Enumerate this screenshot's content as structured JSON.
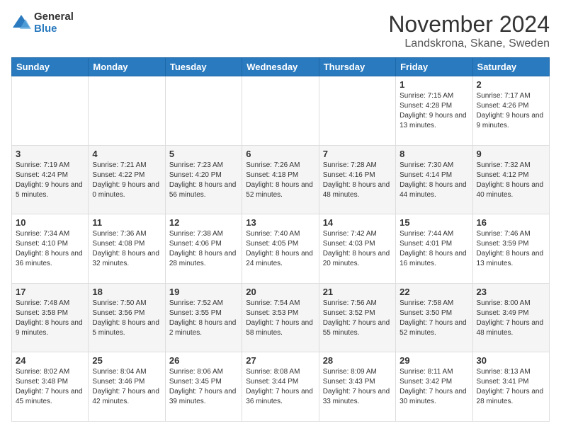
{
  "logo": {
    "general": "General",
    "blue": "Blue"
  },
  "header": {
    "month": "November 2024",
    "location": "Landskrona, Skane, Sweden"
  },
  "weekdays": [
    "Sunday",
    "Monday",
    "Tuesday",
    "Wednesday",
    "Thursday",
    "Friday",
    "Saturday"
  ],
  "weeks": [
    [
      {
        "day": "",
        "info": ""
      },
      {
        "day": "",
        "info": ""
      },
      {
        "day": "",
        "info": ""
      },
      {
        "day": "",
        "info": ""
      },
      {
        "day": "",
        "info": ""
      },
      {
        "day": "1",
        "info": "Sunrise: 7:15 AM\nSunset: 4:28 PM\nDaylight: 9 hours\nand 13 minutes."
      },
      {
        "day": "2",
        "info": "Sunrise: 7:17 AM\nSunset: 4:26 PM\nDaylight: 9 hours\nand 9 minutes."
      }
    ],
    [
      {
        "day": "3",
        "info": "Sunrise: 7:19 AM\nSunset: 4:24 PM\nDaylight: 9 hours\nand 5 minutes."
      },
      {
        "day": "4",
        "info": "Sunrise: 7:21 AM\nSunset: 4:22 PM\nDaylight: 9 hours\nand 0 minutes."
      },
      {
        "day": "5",
        "info": "Sunrise: 7:23 AM\nSunset: 4:20 PM\nDaylight: 8 hours\nand 56 minutes."
      },
      {
        "day": "6",
        "info": "Sunrise: 7:26 AM\nSunset: 4:18 PM\nDaylight: 8 hours\nand 52 minutes."
      },
      {
        "day": "7",
        "info": "Sunrise: 7:28 AM\nSunset: 4:16 PM\nDaylight: 8 hours\nand 48 minutes."
      },
      {
        "day": "8",
        "info": "Sunrise: 7:30 AM\nSunset: 4:14 PM\nDaylight: 8 hours\nand 44 minutes."
      },
      {
        "day": "9",
        "info": "Sunrise: 7:32 AM\nSunset: 4:12 PM\nDaylight: 8 hours\nand 40 minutes."
      }
    ],
    [
      {
        "day": "10",
        "info": "Sunrise: 7:34 AM\nSunset: 4:10 PM\nDaylight: 8 hours\nand 36 minutes."
      },
      {
        "day": "11",
        "info": "Sunrise: 7:36 AM\nSunset: 4:08 PM\nDaylight: 8 hours\nand 32 minutes."
      },
      {
        "day": "12",
        "info": "Sunrise: 7:38 AM\nSunset: 4:06 PM\nDaylight: 8 hours\nand 28 minutes."
      },
      {
        "day": "13",
        "info": "Sunrise: 7:40 AM\nSunset: 4:05 PM\nDaylight: 8 hours\nand 24 minutes."
      },
      {
        "day": "14",
        "info": "Sunrise: 7:42 AM\nSunset: 4:03 PM\nDaylight: 8 hours\nand 20 minutes."
      },
      {
        "day": "15",
        "info": "Sunrise: 7:44 AM\nSunset: 4:01 PM\nDaylight: 8 hours\nand 16 minutes."
      },
      {
        "day": "16",
        "info": "Sunrise: 7:46 AM\nSunset: 3:59 PM\nDaylight: 8 hours\nand 13 minutes."
      }
    ],
    [
      {
        "day": "17",
        "info": "Sunrise: 7:48 AM\nSunset: 3:58 PM\nDaylight: 8 hours\nand 9 minutes."
      },
      {
        "day": "18",
        "info": "Sunrise: 7:50 AM\nSunset: 3:56 PM\nDaylight: 8 hours\nand 5 minutes."
      },
      {
        "day": "19",
        "info": "Sunrise: 7:52 AM\nSunset: 3:55 PM\nDaylight: 8 hours\nand 2 minutes."
      },
      {
        "day": "20",
        "info": "Sunrise: 7:54 AM\nSunset: 3:53 PM\nDaylight: 7 hours\nand 58 minutes."
      },
      {
        "day": "21",
        "info": "Sunrise: 7:56 AM\nSunset: 3:52 PM\nDaylight: 7 hours\nand 55 minutes."
      },
      {
        "day": "22",
        "info": "Sunrise: 7:58 AM\nSunset: 3:50 PM\nDaylight: 7 hours\nand 52 minutes."
      },
      {
        "day": "23",
        "info": "Sunrise: 8:00 AM\nSunset: 3:49 PM\nDaylight: 7 hours\nand 48 minutes."
      }
    ],
    [
      {
        "day": "24",
        "info": "Sunrise: 8:02 AM\nSunset: 3:48 PM\nDaylight: 7 hours\nand 45 minutes."
      },
      {
        "day": "25",
        "info": "Sunrise: 8:04 AM\nSunset: 3:46 PM\nDaylight: 7 hours\nand 42 minutes."
      },
      {
        "day": "26",
        "info": "Sunrise: 8:06 AM\nSunset: 3:45 PM\nDaylight: 7 hours\nand 39 minutes."
      },
      {
        "day": "27",
        "info": "Sunrise: 8:08 AM\nSunset: 3:44 PM\nDaylight: 7 hours\nand 36 minutes."
      },
      {
        "day": "28",
        "info": "Sunrise: 8:09 AM\nSunset: 3:43 PM\nDaylight: 7 hours\nand 33 minutes."
      },
      {
        "day": "29",
        "info": "Sunrise: 8:11 AM\nSunset: 3:42 PM\nDaylight: 7 hours\nand 30 minutes."
      },
      {
        "day": "30",
        "info": "Sunrise: 8:13 AM\nSunset: 3:41 PM\nDaylight: 7 hours\nand 28 minutes."
      }
    ]
  ]
}
